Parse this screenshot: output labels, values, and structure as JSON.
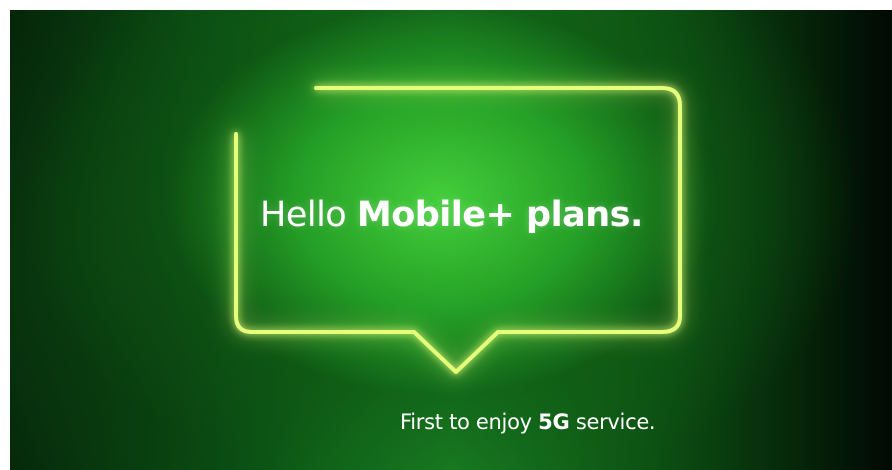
{
  "banner": {
    "headline_prefix": "Hello",
    "headline_bold": "Mobile+ plans.",
    "tagline_prefix": "First to enjoy",
    "tagline_bold": "5G",
    "tagline_suffix": "service."
  },
  "colors": {
    "glow": "#e6ff7a",
    "background_green": "#1f9a2a",
    "text": "#ffffff"
  }
}
